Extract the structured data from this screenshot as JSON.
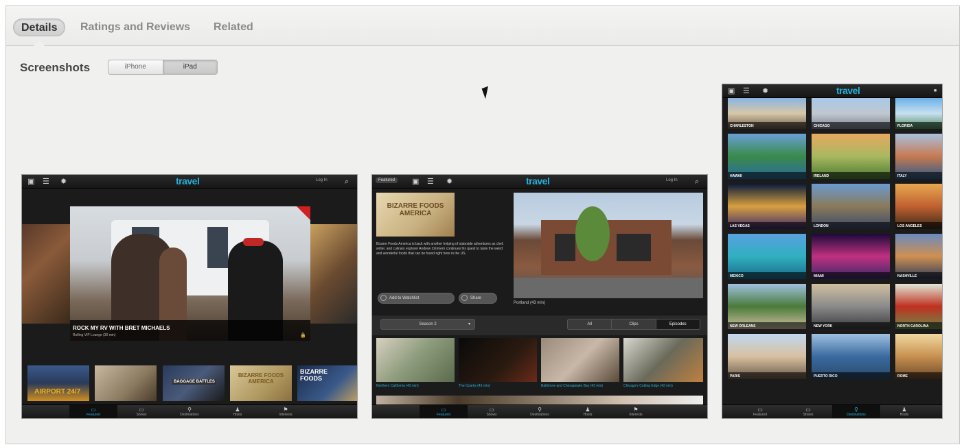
{
  "tabs": [
    "Details",
    "Ratings and Reviews",
    "Related"
  ],
  "active_tab": "Details",
  "screenshots": {
    "heading": "Screenshots",
    "devices": [
      "iPhone",
      "iPad"
    ],
    "selected_device": "iPad"
  },
  "app": {
    "logo": "travel",
    "login": "Log In",
    "featured_label": "Featured",
    "nav": [
      "Featured",
      "Shows",
      "Destinations",
      "Hosts",
      "Interests"
    ]
  },
  "shot1": {
    "hero_title": "ROCK MY RV WITH BRET MICHAELS",
    "hero_sub": "Rolling VIP Lounge (30 min)",
    "thumb_labels": [
      "AIRPORT 24/7",
      "BIZARRE FOODS AMERICA",
      "BAGGAGE BATTLES",
      "BIZARRE FOODS"
    ]
  },
  "shot2": {
    "show_logo": "BIZARRE FOODS AMERICA",
    "description": "Bizarre Foods America is back with another helping of stateside adventures as chef, writer, and culinary explorer Andrew Zimmern continues his quest to taste the weird and wonderful foods that can be found right here in the US.",
    "watchlist": "Add to Watchlist",
    "share": "Share",
    "video_caption": "Portland (43 min)",
    "season": "Season 2",
    "filters": [
      "All",
      "Clips",
      "Episodes"
    ],
    "selected_filter": "Episodes",
    "episodes": [
      "Northern California (43 min)",
      "The Ozarks (43 min)",
      "Baltimore and Chesapeake Bay (43 min)",
      "Chicago's Cutting Edge (43 min)"
    ]
  },
  "shot3": {
    "cities": [
      "CHARLESTON",
      "CHICAGO",
      "FLORIDA",
      "HAWAII",
      "IRELAND",
      "ITALY",
      "LAS VEGAS",
      "LONDON",
      "LOS ANGELES",
      "MEXICO",
      "MIAMI",
      "NASHVILLE",
      "NEW ORLEANS",
      "NEW YORK",
      "NORTH CAROLINA",
      "PARIS",
      "PUERTO RICO",
      "ROME"
    ]
  }
}
